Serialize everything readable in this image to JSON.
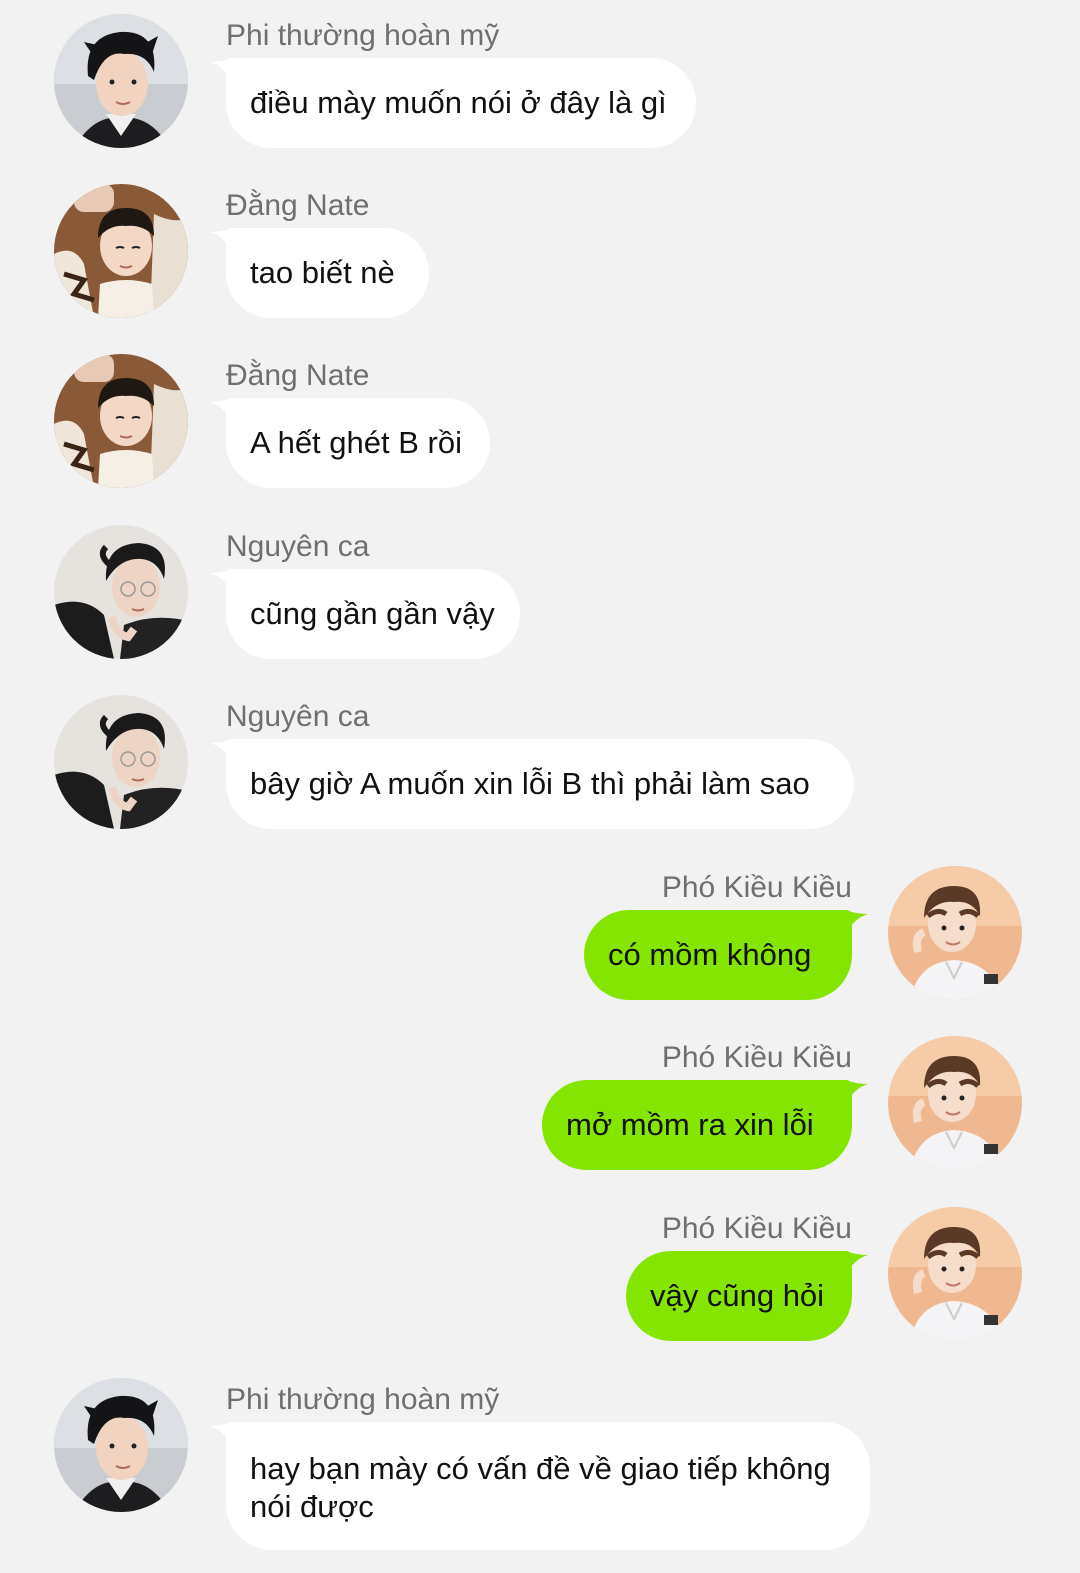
{
  "messages": [
    {
      "side": "left",
      "sender": "Phi thường hoàn mỹ",
      "text": "điều mày muốn nói ở đây là gì",
      "avatar": "avatar-phi"
    },
    {
      "side": "left",
      "sender": "Đằng Nate",
      "text": "tao biết nè",
      "avatar": "avatar-dang"
    },
    {
      "side": "left",
      "sender": "Đằng Nate",
      "text": "A hết ghét B rồi",
      "avatar": "avatar-dang"
    },
    {
      "side": "left",
      "sender": "Nguyên ca",
      "text": "cũng gần gần vậy",
      "avatar": "avatar-nguyen"
    },
    {
      "side": "left",
      "sender": "Nguyên ca",
      "text": "bây giờ A muốn xin lỗi B thì phải làm sao",
      "avatar": "avatar-nguyen"
    },
    {
      "side": "right",
      "sender": "Phó Kiều Kiều",
      "text": "có mồm không",
      "avatar": "avatar-pho"
    },
    {
      "side": "right",
      "sender": "Phó Kiều Kiều",
      "text": "mở mồm ra xin lỗi",
      "avatar": "avatar-pho"
    },
    {
      "side": "right",
      "sender": "Phó Kiều Kiều",
      "text": "vậy cũng hỏi",
      "avatar": "avatar-pho"
    },
    {
      "side": "left",
      "sender": "Phi thường hoàn mỹ",
      "text_line1": "hay bạn mày có vấn đề về giao tiếp không",
      "text_line2": "nói được",
      "avatar": "avatar-phi"
    }
  ],
  "colors": {
    "background": "#f2f2f2",
    "incoming_bubble": "#ffffff",
    "outgoing_bubble": "#84e600",
    "sender_name": "#6f6f6f"
  }
}
